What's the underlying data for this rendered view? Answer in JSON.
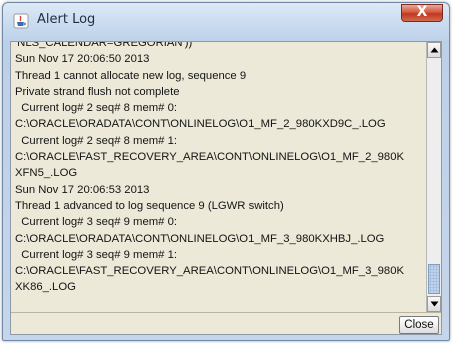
{
  "window": {
    "title": "Alert Log",
    "close_glyph": "X"
  },
  "log": {
    "lines": [
      "'NLS_CALENDAR=GREGORIAN'))",
      "Sun Nov 17 20:06:50 2013",
      "Thread 1 cannot allocate new log, sequence 9",
      "Private strand flush not complete",
      "  Current log# 2 seq# 8 mem# 0:",
      "C:\\ORACLE\\ORADATA\\CONT\\ONLINELOG\\O1_MF_2_980KXD9C_.LOG",
      "  Current log# 2 seq# 8 mem# 1:",
      "C:\\ORACLE\\FAST_RECOVERY_AREA\\CONT\\ONLINELOG\\O1_MF_2_980K",
      "XFN5_.LOG",
      "Sun Nov 17 20:06:53 2013",
      "Thread 1 advanced to log sequence 9 (LGWR switch)",
      "  Current log# 3 seq# 9 mem# 0:",
      "C:\\ORACLE\\ORADATA\\CONT\\ONLINELOG\\O1_MF_3_980KXHBJ_.LOG",
      "  Current log# 3 seq# 9 mem# 1:",
      "C:\\ORACLE\\FAST_RECOVERY_AREA\\CONT\\ONLINELOG\\O1_MF_3_980K",
      "XK86_.LOG"
    ]
  },
  "footer": {
    "close_label": "Close"
  },
  "icons": {
    "app": "java-cup-icon",
    "scroll_up": "arrow-up-icon",
    "scroll_down": "arrow-down-icon"
  },
  "colors": {
    "title_close_bg": "#c9452c",
    "scroll_thumb": "#c5d7f1",
    "panel_bg": "#ece9d8"
  }
}
